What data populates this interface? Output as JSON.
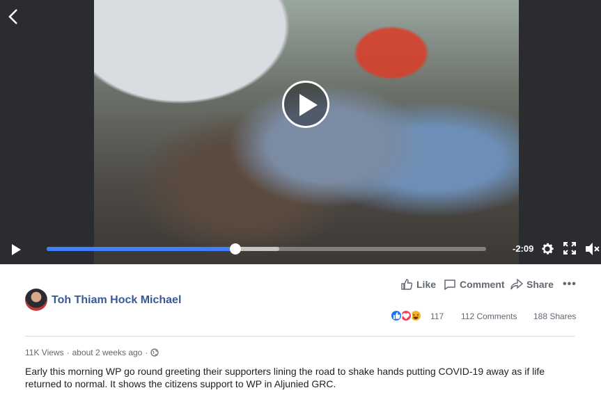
{
  "video": {
    "time_remaining": "-2:09",
    "progress": 0.429,
    "buffered": 0.53,
    "icons": {
      "back": "chevron-left-icon",
      "big_play": "play-circle-icon",
      "play": "play-icon",
      "settings": "gear-icon",
      "fullscreen": "fullscreen-icon",
      "volume": "volume-muted-icon"
    }
  },
  "post": {
    "author": "Toh Thiam Hock Michael",
    "actions": {
      "like": "Like",
      "comment": "Comment",
      "share": "Share",
      "more": "•••"
    },
    "reaction_count": "117",
    "comments": "112 Comments",
    "shares": "188 Shares",
    "views": "11K Views",
    "separator": "·",
    "time_ago": "about 2 weeks ago",
    "separator2": "·",
    "description": "Early this morning WP go round greeting their supporters lining the road to shake hands putting COVID-19 away as if life returned to normal. It shows the citizens support to WP in Aljunied GRC."
  },
  "colors": {
    "link": "#385898",
    "progress": "#4080ff",
    "like": "#1877f2",
    "love": "#f33e58",
    "haha": "#f7b125"
  }
}
